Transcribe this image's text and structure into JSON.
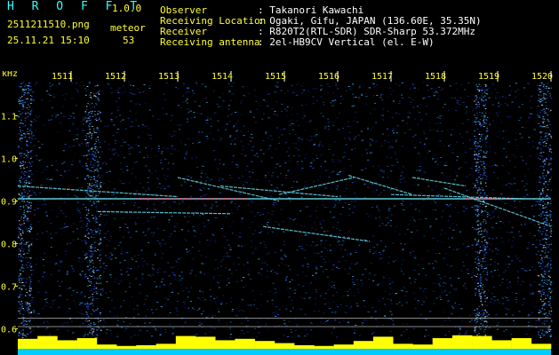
{
  "header": {
    "brand": "H R O F F T",
    "version": "1.0.0",
    "filename": "2511211510.png",
    "datetime": "25.11.21 15:10",
    "meteor_label": "meteor",
    "meteor_count": "53",
    "info": [
      {
        "key": "Observer",
        "value": ": Takanori Kawachi"
      },
      {
        "key": "Receiving Location",
        "value": ": Ogaki, Gifu, JAPAN (136.60E, 35.35N)"
      },
      {
        "key": "Receiver",
        "value": ": R820T2(RTL-SDR) SDR-Sharp 53.372MHz"
      },
      {
        "key": "Receiving antenna",
        "value": ": 2el-HB9CV Vertical (el. E-W)"
      }
    ]
  },
  "colors": {
    "yellow_text": "#ffff33",
    "cyan_text": "#33ffff",
    "background": "#000000",
    "noise_base": "#1a2a8c",
    "echo": "#66ddee",
    "echo_hot": "#ff4466",
    "bottom_bars": "#ffff00",
    "bottom_base": "#00ccff"
  },
  "chart_data": {
    "type": "heatmap",
    "title": "",
    "y_unit_label": "kHz",
    "x_ticks": [
      "1511",
      "1512",
      "1513",
      "1514",
      "1515",
      "1516",
      "1517",
      "1518",
      "1519",
      "1520"
    ],
    "y_ticks": [
      {
        "value": 1.1,
        "label": "1.1"
      },
      {
        "value": 1.0,
        "label": "1.0"
      },
      {
        "value": 0.9,
        "label": "0.9"
      },
      {
        "value": 0.8,
        "label": "0.8"
      },
      {
        "value": 0.7,
        "label": "0.7"
      },
      {
        "value": 0.6,
        "label": "0.6"
      }
    ],
    "x_range_minutes": [
      1510.0,
      1520.0
    ],
    "y_range_khz": [
      0.58,
      1.18
    ],
    "carrier": {
      "freq_khz": 0.905,
      "from": 1510.0,
      "to": 1520.0
    },
    "echoes": [
      {
        "x0": 1510.0,
        "y0": 0.935,
        "x1": 1513.0,
        "y1": 0.91
      },
      {
        "x0": 1511.5,
        "y0": 0.875,
        "x1": 1514.0,
        "y1": 0.87
      },
      {
        "x0": 1513.0,
        "y0": 0.955,
        "x1": 1514.9,
        "y1": 0.9
      },
      {
        "x0": 1513.8,
        "y0": 0.935,
        "x1": 1516.0,
        "y1": 0.91
      },
      {
        "x0": 1514.9,
        "y0": 0.915,
        "x1": 1516.3,
        "y1": 0.955
      },
      {
        "x0": 1516.2,
        "y0": 0.96,
        "x1": 1517.4,
        "y1": 0.915
      },
      {
        "x0": 1517.0,
        "y0": 0.915,
        "x1": 1519.5,
        "y1": 0.905
      },
      {
        "x0": 1514.6,
        "y0": 0.84,
        "x1": 1516.6,
        "y1": 0.805
      },
      {
        "x0": 1517.4,
        "y0": 0.955,
        "x1": 1518.4,
        "y1": 0.935
      },
      {
        "x0": 1518.0,
        "y0": 0.93,
        "x1": 1520.0,
        "y1": 0.84
      }
    ],
    "noise_bands": [
      {
        "from": 1510.0,
        "to": 1510.25
      },
      {
        "from": 1511.25,
        "to": 1511.55
      },
      {
        "from": 1518.55,
        "to": 1518.8
      },
      {
        "from": 1519.75,
        "to": 1520.0
      }
    ],
    "bottom_level": [
      0.7,
      0.9,
      0.6,
      0.75,
      0.3,
      0.2,
      0.25,
      0.35,
      0.9,
      0.85,
      0.6,
      0.7,
      0.55,
      0.4,
      0.25,
      0.2,
      0.3,
      0.55,
      0.85,
      0.35,
      0.3,
      0.75,
      0.95,
      0.9,
      0.6,
      0.75,
      0.35
    ]
  }
}
